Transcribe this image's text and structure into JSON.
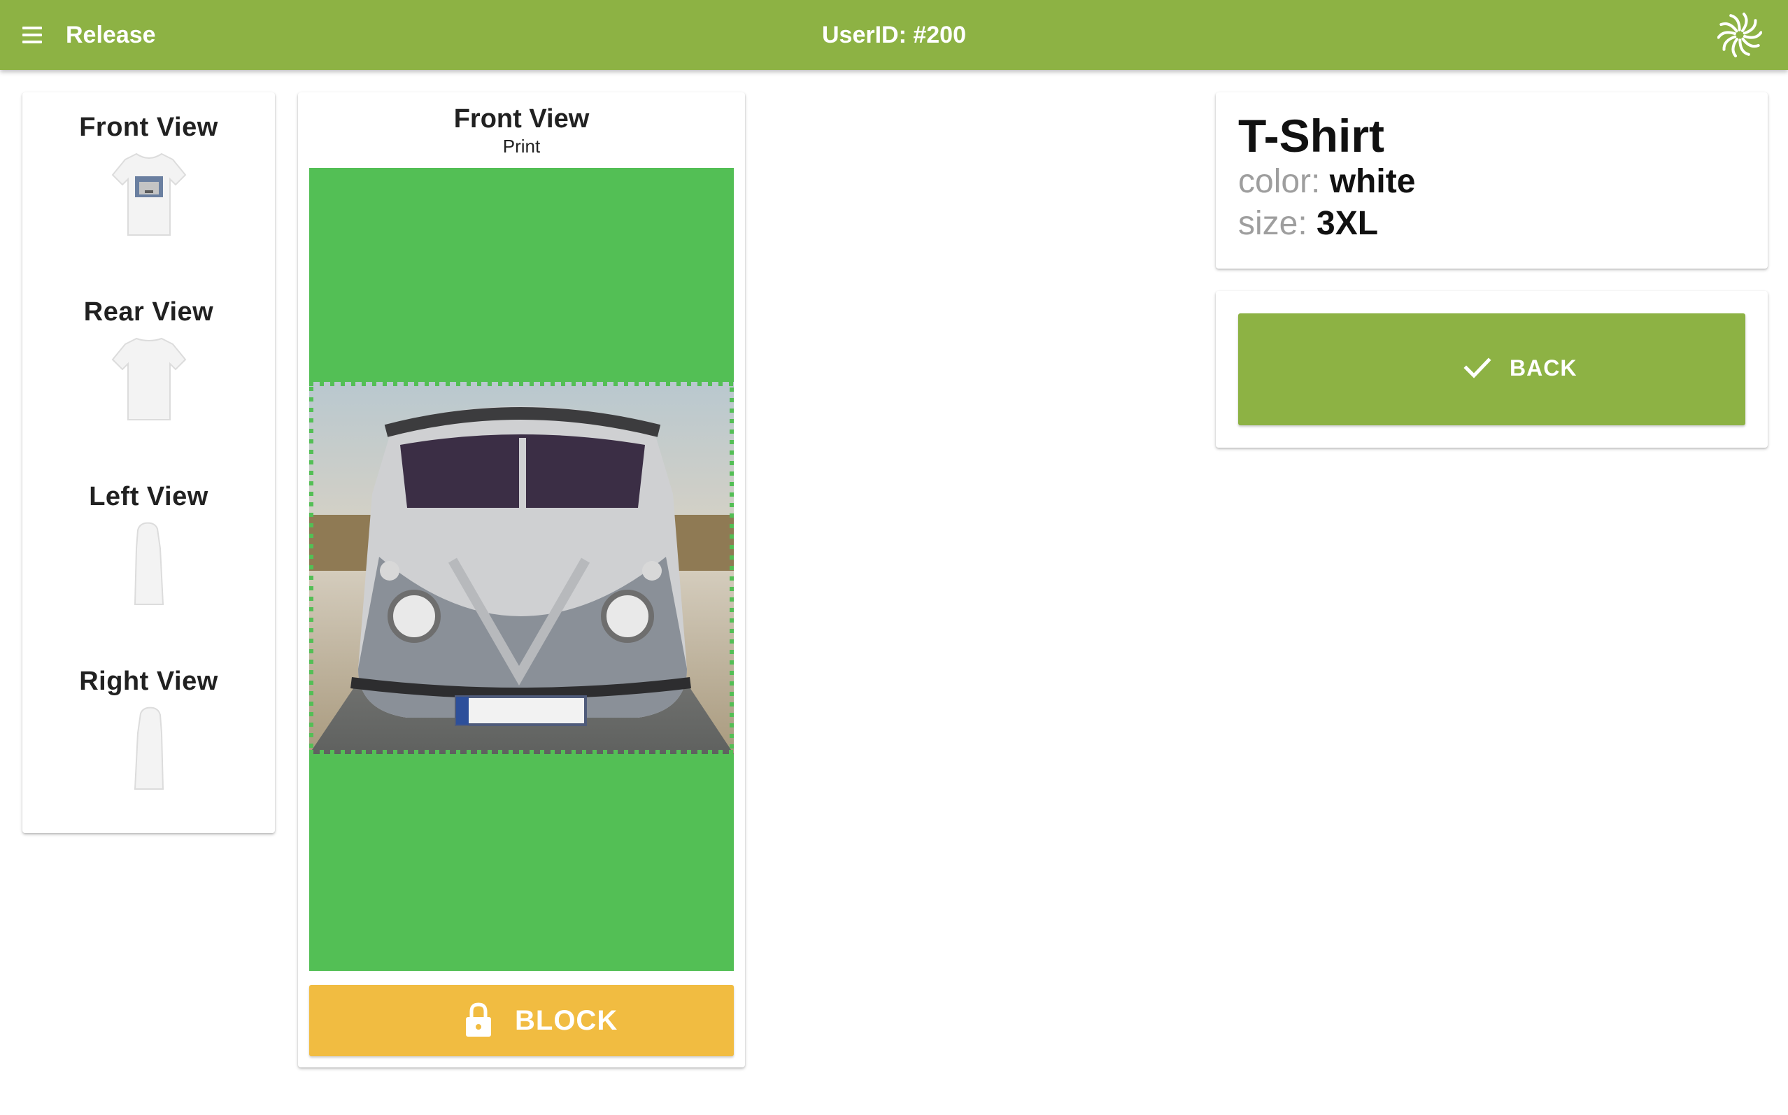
{
  "header": {
    "title": "Release",
    "user_id": "UserID: #200",
    "menu_icon": "menu-icon",
    "logo_icon": "swirl-logo-icon",
    "color": "#8db244"
  },
  "views": {
    "items": [
      {
        "label": "Front View",
        "icon": "tshirt-front-thumbnail"
      },
      {
        "label": "Rear View",
        "icon": "tshirt-rear-thumbnail"
      },
      {
        "label": "Left View",
        "icon": "tshirt-left-thumbnail"
      },
      {
        "label": "Right View",
        "icon": "tshirt-right-thumbnail"
      }
    ]
  },
  "print": {
    "title": "Front View",
    "subtitle": "Print",
    "area_color": "#53bf55",
    "image": "vw-bus-print-image",
    "block_label": "BLOCK",
    "block_icon": "lock-icon",
    "block_color": "#f1bc41"
  },
  "product": {
    "name": "T-Shirt",
    "color_key": "color:",
    "color_value": "white",
    "size_key": "size:",
    "size_value": "3XL"
  },
  "actions": {
    "back_label": "BACK",
    "back_icon": "check-icon"
  }
}
